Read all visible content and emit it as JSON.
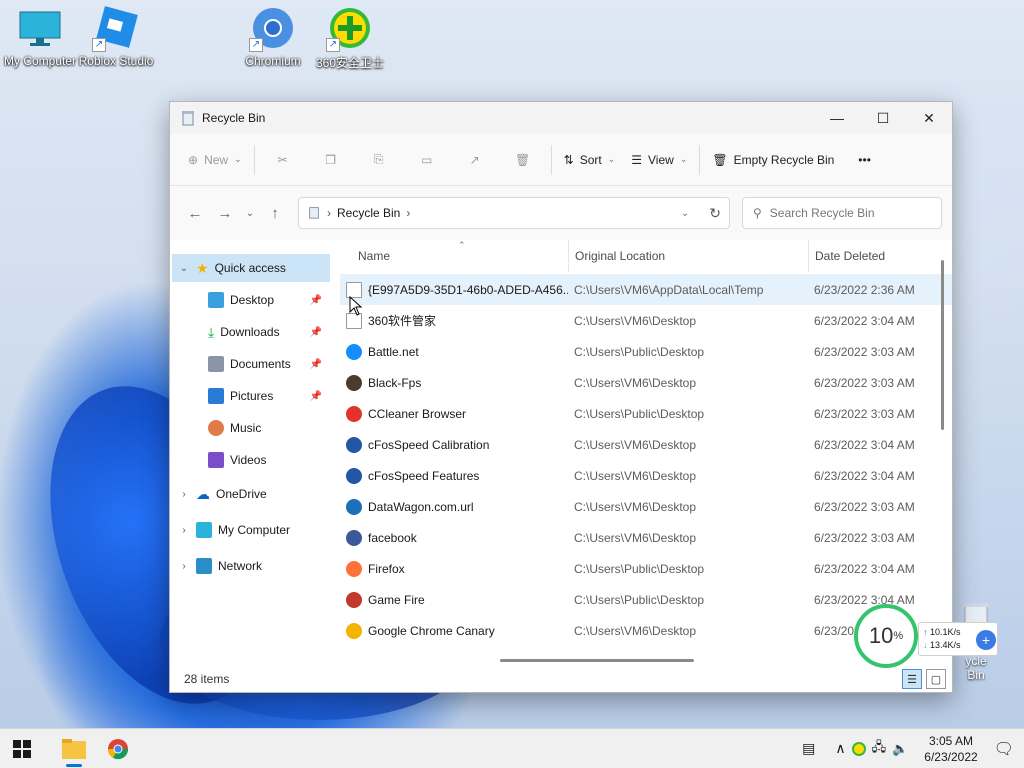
{
  "desktop": {
    "icons": [
      {
        "label": "My Computer"
      },
      {
        "label": "Roblox Studio"
      },
      {
        "label": "Chromium"
      },
      {
        "label": "360安全卫士"
      }
    ],
    "recycle_partial_label": "ycle Bin"
  },
  "window": {
    "title": "Recycle Bin",
    "controls": {
      "minimize": "—",
      "maximize": "☐",
      "close": "✕"
    }
  },
  "commandbar": {
    "new_label": "New",
    "sort_label": "Sort",
    "view_label": "View",
    "empty_label": "Empty Recycle Bin",
    "more_label": "•••"
  },
  "navbar": {
    "breadcrumb": "Recycle Bin",
    "search_placeholder": "Search Recycle Bin"
  },
  "sidebar": {
    "quick_access": "Quick access",
    "pinned": [
      {
        "label": "Desktop",
        "pinned": true
      },
      {
        "label": "Downloads",
        "pinned": true
      },
      {
        "label": "Documents",
        "pinned": true
      },
      {
        "label": "Pictures",
        "pinned": true
      },
      {
        "label": "Music",
        "pinned": false
      },
      {
        "label": "Videos",
        "pinned": false
      }
    ],
    "onedrive": "OneDrive",
    "mycomputer": "My Computer",
    "network": "Network"
  },
  "columns": {
    "name": "Name",
    "location": "Original Location",
    "date": "Date Deleted"
  },
  "files": [
    {
      "name": "{E997A5D9-35D1-46b0-ADED-A456...",
      "location": "C:\\Users\\VM6\\AppData\\Local\\Temp",
      "date": "6/23/2022 2:36 AM",
      "color": "#ffffff",
      "icon": "blank-file-icon"
    },
    {
      "name": "360软件管家",
      "location": "C:\\Users\\VM6\\Desktop",
      "date": "6/23/2022 3:04 AM",
      "color": "#ffffff",
      "icon": "shortcut-icon"
    },
    {
      "name": "Battle.net",
      "location": "C:\\Users\\Public\\Desktop",
      "date": "6/23/2022 3:03 AM",
      "color": "#148eff",
      "icon": "battlenet-icon"
    },
    {
      "name": "Black-Fps",
      "location": "C:\\Users\\VM6\\Desktop",
      "date": "6/23/2022 3:03 AM",
      "color": "#4a3b2c",
      "icon": "blackfps-icon"
    },
    {
      "name": "CCleaner Browser",
      "location": "C:\\Users\\Public\\Desktop",
      "date": "6/23/2022 3:03 AM",
      "color": "#e2322b",
      "icon": "ccleaner-icon"
    },
    {
      "name": "cFosSpeed Calibration",
      "location": "C:\\Users\\VM6\\Desktop",
      "date": "6/23/2022 3:04 AM",
      "color": "#2456a6",
      "icon": "cfosspeed-icon"
    },
    {
      "name": "cFosSpeed Features",
      "location": "C:\\Users\\VM6\\Desktop",
      "date": "6/23/2022 3:04 AM",
      "color": "#2456a6",
      "icon": "cfosspeed-icon"
    },
    {
      "name": "DataWagon.com.url",
      "location": "C:\\Users\\VM6\\Desktop",
      "date": "6/23/2022 3:03 AM",
      "color": "#1d6fb8",
      "icon": "url-icon"
    },
    {
      "name": "facebook",
      "location": "C:\\Users\\VM6\\Desktop",
      "date": "6/23/2022 3:03 AM",
      "color": "#3b5998",
      "icon": "facebook-icon"
    },
    {
      "name": "Firefox",
      "location": "C:\\Users\\Public\\Desktop",
      "date": "6/23/2022 3:04 AM",
      "color": "#ff7139",
      "icon": "firefox-icon"
    },
    {
      "name": "Game Fire",
      "location": "C:\\Users\\Public\\Desktop",
      "date": "6/23/2022 3:04 AM",
      "color": "#c0392b",
      "icon": "gamefire-icon"
    },
    {
      "name": "Google Chrome Canary",
      "location": "C:\\Users\\VM6\\Desktop",
      "date": "6/23/202",
      "color": "#f4b400",
      "icon": "chrome-canary-icon"
    }
  ],
  "status": {
    "item_count": "28 items"
  },
  "netwidget": {
    "percent": "10",
    "percent_sign": "%",
    "up": "10.1K/s",
    "down": "13.4K/s"
  },
  "taskbar": {
    "time": "3:05 AM",
    "date": "6/23/2022"
  },
  "colors": {
    "accent": "#0078d4",
    "selection": "#cce4f7",
    "hover": "#e5f1fb"
  }
}
